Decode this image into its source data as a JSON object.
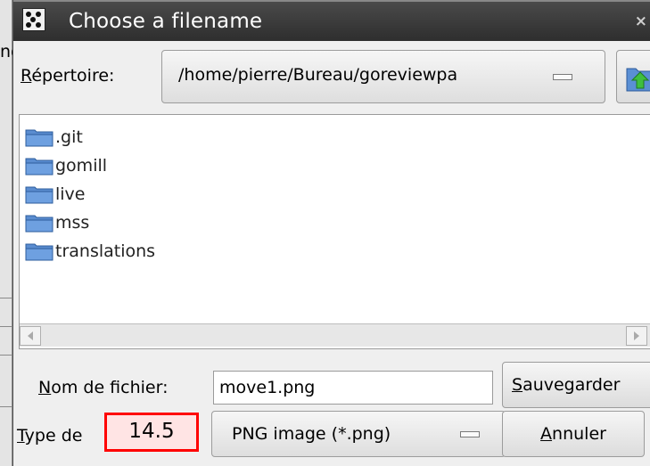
{
  "window": {
    "title": "Choose a filename",
    "close_glyph": "×",
    "bg_sliver_text": "ne"
  },
  "directory": {
    "label": "Répertoire:",
    "label_mnemonic": "R",
    "label_rest": "épertoire:",
    "path": "/home/pierre/Bureau/goreviewpa",
    "up_icon": "folder-up-icon"
  },
  "files": [
    {
      "name": ".git",
      "icon": "folder-icon"
    },
    {
      "name": "gomill",
      "icon": "folder-icon"
    },
    {
      "name": "live",
      "icon": "folder-icon"
    },
    {
      "name": "mss",
      "icon": "folder-icon"
    },
    {
      "name": "translations",
      "icon": "folder-icon"
    }
  ],
  "filename": {
    "label_mnemonic": "N",
    "label_rest": "om de fichier:",
    "value": "move1.png"
  },
  "filetype": {
    "label_mnemonic": "T",
    "label_rest": "ype de",
    "selected": "PNG image (*.png)"
  },
  "buttons": {
    "save_mnemonic": "S",
    "save_rest": "auvegarder",
    "cancel_mnemonic": "A",
    "cancel_rest": "nnuler"
  },
  "overlay": {
    "value": "14.5"
  },
  "colors": {
    "titlebar": "#3a3a3a",
    "folder": "#4f7fc4",
    "overlay_border": "#ff0000",
    "overlay_fill": "#ffe4e4"
  }
}
